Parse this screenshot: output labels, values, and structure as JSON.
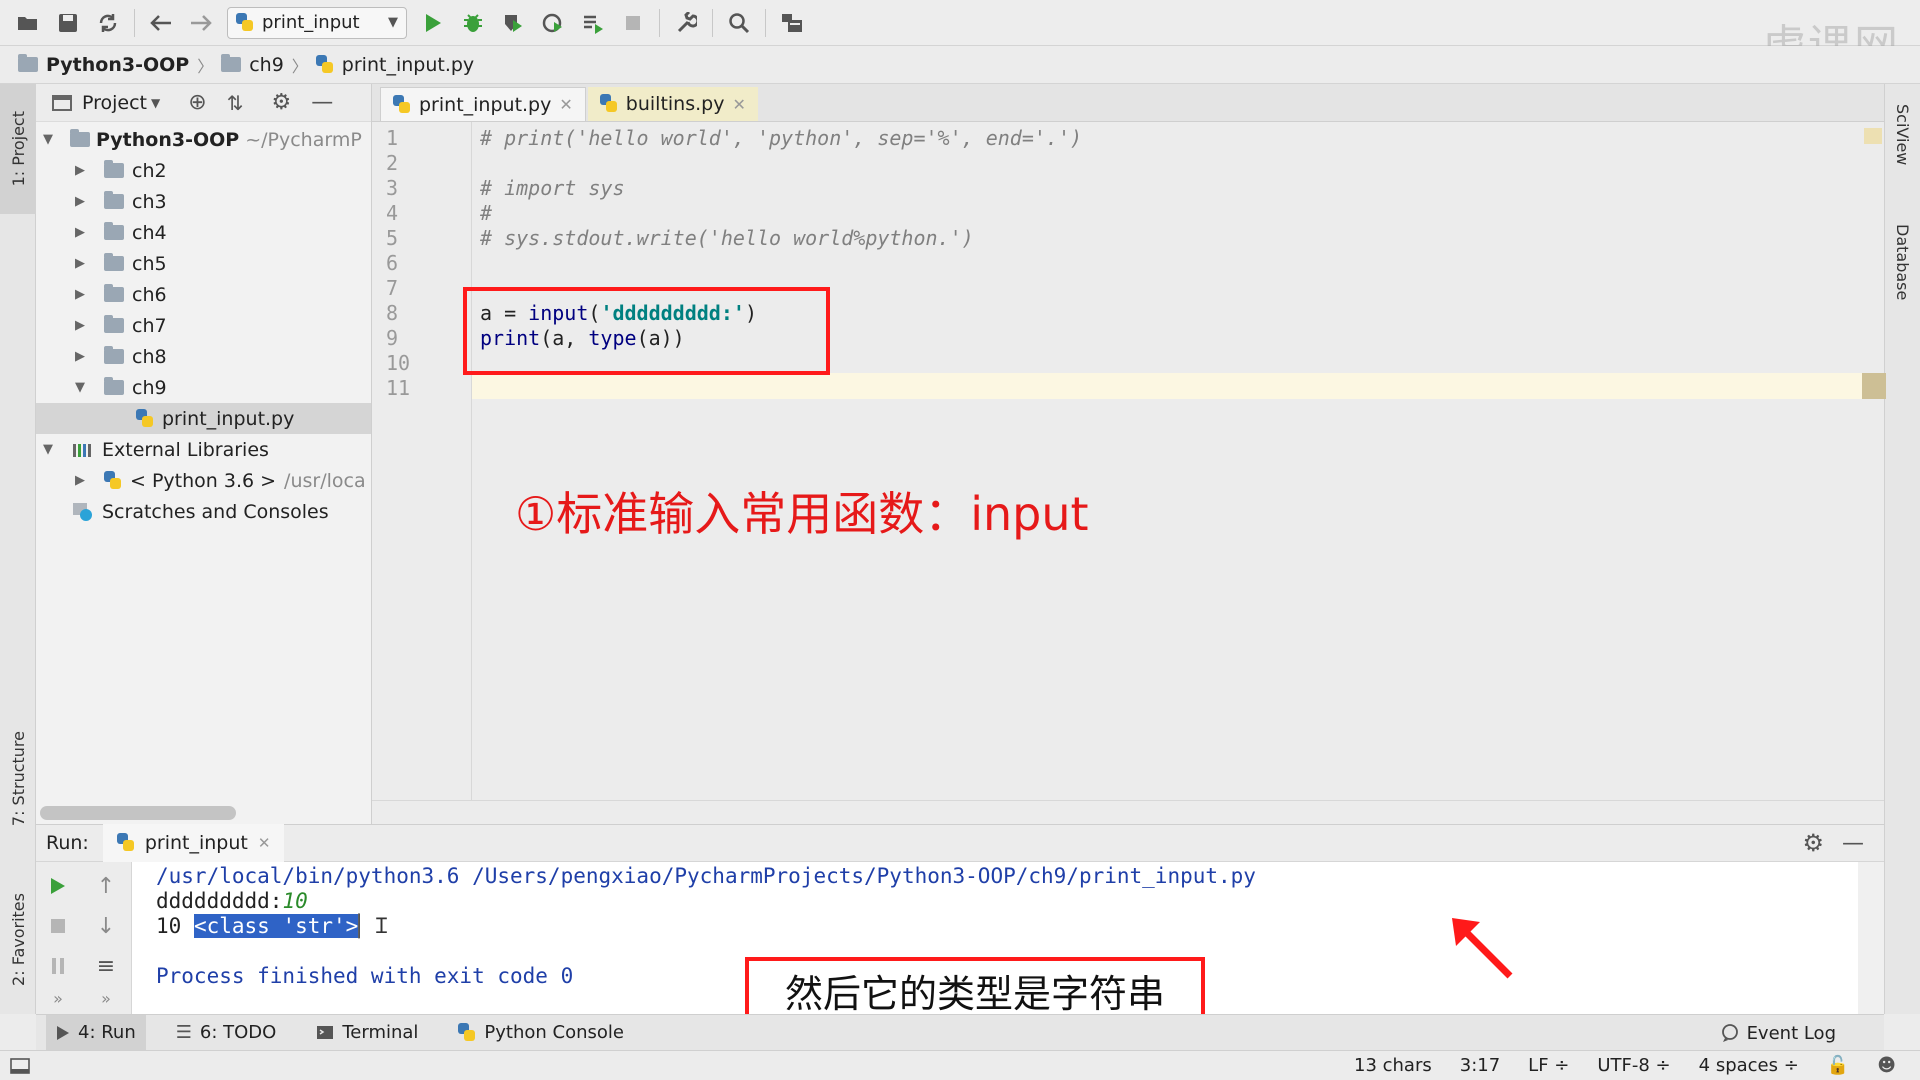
{
  "toolbar": {
    "run_config": "print_input",
    "watermark": "虎课网"
  },
  "breadcrumb": [
    "Python3-OOP",
    "ch9",
    "print_input.py"
  ],
  "stripes": {
    "left_top": "1: Project",
    "left_structure": "7: Structure",
    "left_favorites": "2: Favorites",
    "right_sciview": "SciView",
    "right_database": "Database"
  },
  "project": {
    "header": "Project",
    "root": {
      "label": "Python3-OOP",
      "path": "~/PycharmP"
    },
    "folders": [
      "ch2",
      "ch3",
      "ch4",
      "ch5",
      "ch6",
      "ch7",
      "ch8",
      "ch9"
    ],
    "open_file": "print_input.py",
    "external": "External Libraries",
    "python_sdk": {
      "label": "< Python 3.6 >",
      "path": "/usr/loca"
    },
    "scratches": "Scratches and Consoles"
  },
  "editor": {
    "tabs": [
      "print_input.py",
      "builtins.py"
    ],
    "line_numbers": [
      "1",
      "2",
      "3",
      "4",
      "5",
      "6",
      "7",
      "8",
      "9",
      "10",
      "11"
    ],
    "line1": "# print('hello world', 'python', sep='%', end='.')",
    "line3": "# import sys",
    "line4": "#",
    "line5": "# sys.stdout.write('hello world%python.')",
    "line8": {
      "a": "a = ",
      "fn": "input",
      "open": "(",
      "str": "'ddddddddd:'",
      "close": ")"
    },
    "line9": {
      "fn1": "print",
      "mid": "(a, ",
      "fn2": "type",
      "end": "(a))"
    },
    "annotation": "①标准输入常用函数：input"
  },
  "run": {
    "label": "Run:",
    "tab": "print_input",
    "cmd": "/usr/local/bin/python3.6 /Users/pengxiao/PycharmProjects/Python3-OOP/ch9/print_input.py",
    "prompt": "ddddddddd:",
    "user_input": "10",
    "out_value": "10 ",
    "out_type": "<class 'str'>",
    "exit": "Process finished with exit code 0",
    "subtitle": "然后它的类型是字符串"
  },
  "bottom_tabs": [
    "4: Run",
    "6: TODO",
    "Terminal",
    "Python Console"
  ],
  "event_log": "Event Log",
  "status": {
    "chars": "13 chars",
    "pos": "3:17",
    "lf": "LF ÷",
    "enc": "UTF-8 ÷",
    "indent": "4 spaces ÷"
  }
}
